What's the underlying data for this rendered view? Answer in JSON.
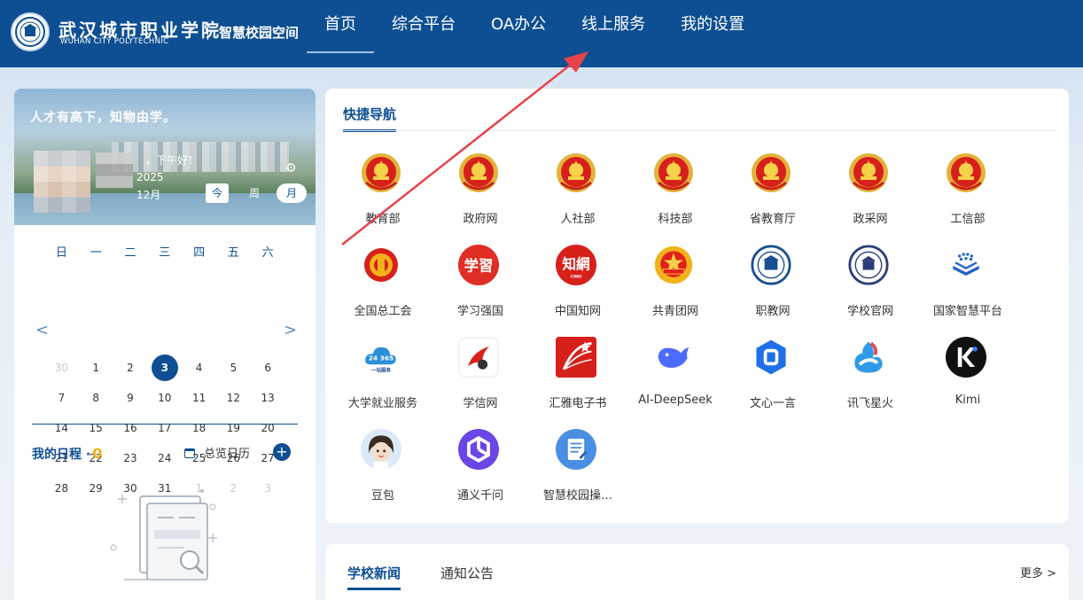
{
  "header": {
    "school_name_cn": "武汉城市职业学院",
    "school_name_en": "WUHAN CITY POLYTECHNIC",
    "subtitle": "智慧校园空间",
    "nav": [
      {
        "label": "首页",
        "active": true
      },
      {
        "label": "综合平台"
      },
      {
        "label": "OA办公"
      },
      {
        "label": "线上服务"
      },
      {
        "label": "我的设置"
      }
    ]
  },
  "profile": {
    "motto": "人才有高下，知物由学。",
    "greeting": "，下午好！",
    "year": "2025",
    "month": "12月",
    "view_today": "今",
    "view_week": "周",
    "view_month": "月"
  },
  "calendar": {
    "weekdays": [
      "日",
      "一",
      "二",
      "三",
      "四",
      "五",
      "六"
    ],
    "rows": [
      [
        "30",
        "1",
        "2",
        "3",
        "4",
        "5",
        "6"
      ],
      [
        "7",
        "8",
        "9",
        "10",
        "11",
        "12",
        "13"
      ],
      [
        "14",
        "15",
        "16",
        "17",
        "18",
        "19",
        "20"
      ],
      [
        "21",
        "22",
        "23",
        "24",
        "25",
        "26",
        "27"
      ],
      [
        "28",
        "29",
        "30",
        "31",
        "1",
        "2",
        "3"
      ]
    ],
    "today": "3",
    "prev_symbol": "<",
    "next_symbol": ">"
  },
  "schedule": {
    "title": "我的日程 ·",
    "count": "0",
    "overview": "总览日历",
    "add": "+"
  },
  "quick_nav": {
    "tab": "快捷导航",
    "items": [
      {
        "label": "教育部",
        "icon": "national-emblem-icon"
      },
      {
        "label": "政府网",
        "icon": "national-emblem-icon"
      },
      {
        "label": "人社部",
        "icon": "national-emblem-icon"
      },
      {
        "label": "科技部",
        "icon": "national-emblem-icon"
      },
      {
        "label": "省教育厅",
        "icon": "national-emblem-icon"
      },
      {
        "label": "政采网",
        "icon": "national-emblem-icon"
      },
      {
        "label": "工信部",
        "icon": "national-emblem-icon"
      },
      {
        "label": "全国总工会",
        "icon": "union-emblem-icon"
      },
      {
        "label": "学习强国",
        "icon": "xuexi-icon"
      },
      {
        "label": "中国知网",
        "icon": "cnki-icon"
      },
      {
        "label": "共青团网",
        "icon": "youth-league-icon"
      },
      {
        "label": "职教网",
        "icon": "vocational-edu-icon"
      },
      {
        "label": "学校官网",
        "icon": "school-seal-icon"
      },
      {
        "label": "国家智慧平台",
        "icon": "smart-edu-icon"
      },
      {
        "label": "大学就业服务",
        "icon": "employment-cloud-icon"
      },
      {
        "label": "学信网",
        "icon": "chsi-icon"
      },
      {
        "label": "汇雅电子书",
        "icon": "ebook-icon"
      },
      {
        "label": "AI-DeepSeek",
        "icon": "deepseek-whale-icon"
      },
      {
        "label": "文心一言",
        "icon": "ernie-icon"
      },
      {
        "label": "讯飞星火",
        "icon": "spark-icon"
      },
      {
        "label": "Kimi",
        "icon": "kimi-icon"
      },
      {
        "label": "豆包",
        "icon": "doubao-avatar-icon"
      },
      {
        "label": "通义千问",
        "icon": "qwen-icon"
      },
      {
        "label": "智慧校园操…",
        "icon": "document-icon"
      }
    ]
  },
  "news": {
    "tabs": [
      "学校新闻",
      "通知公告"
    ],
    "more": "更多 >"
  },
  "colors": {
    "primary": "#0e4f93",
    "accent": "#f2b21a",
    "annotation_arrow": "#e8434a"
  }
}
